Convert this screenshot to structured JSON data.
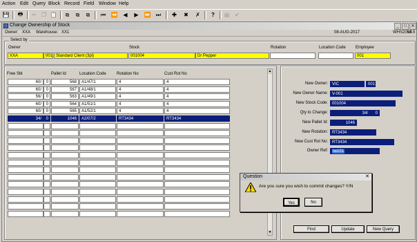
{
  "menu": [
    "Action",
    "Edit",
    "Query",
    "Block",
    "Record",
    "Field",
    "Window",
    "Help"
  ],
  "window": {
    "title": "Change Ownership of Stock"
  },
  "info": {
    "owner_label": "Owner:",
    "owner": "XXA",
    "warehouse_label": "Warehouse:",
    "warehouse": "XX1",
    "date": "08-AUG-2017",
    "program": "WHS2053",
    "version": "v4.5"
  },
  "select_by": {
    "title": "Select by",
    "owner_label": "Owner",
    "owner_code": "XXA",
    "owner_num": "001",
    "owner_name": "Standard Client (3pl)",
    "stock_label": "Stock",
    "stock_code": "001004",
    "stock_name": "Dr Pepper",
    "rotation_label": "Rotation",
    "rotation": "",
    "location_label": "Location Code",
    "location": "",
    "employee_label": "Employee",
    "employee": "001"
  },
  "grid": {
    "headers": [
      "Free Stk",
      "Pallet Id",
      "Location Code",
      "Rotation No",
      "Cust Rot No"
    ],
    "rows": [
      {
        "free": "60/",
        "free2": "0",
        "pallet": "568",
        "location": "A1/47/1",
        "rotation": "4",
        "cust_rot": "4",
        "selected": false
      },
      {
        "free": "60/",
        "free2": "0",
        "pallet": "567",
        "location": "A1/48/1",
        "rotation": "4",
        "cust_rot": "4",
        "selected": false
      },
      {
        "free": "56/",
        "free2": "0",
        "pallet": "563",
        "location": "A1/49/1",
        "rotation": "4",
        "cust_rot": "4",
        "selected": false
      },
      {
        "free": "60/",
        "free2": "0",
        "pallet": "564",
        "location": "A1/51/1",
        "rotation": "4",
        "cust_rot": "4",
        "selected": false
      },
      {
        "free": "60/",
        "free2": "0",
        "pallet": "565",
        "location": "A1/52/1",
        "rotation": "4",
        "cust_rot": "4",
        "selected": false
      },
      {
        "free": "34/",
        "free2": "0",
        "pallet": "1046",
        "location": "A2/07/2",
        "rotation": "RT3434",
        "cust_rot": "RT3434",
        "selected": true
      }
    ],
    "empty_rows": 13
  },
  "right": {
    "new_owner_label": "New Owner:",
    "new_owner": "VIC",
    "new_owner_num": "001",
    "new_owner_name_label": "New Owner Name:",
    "new_owner_name": "V-001",
    "new_stock_label": "New Stock Code:",
    "new_stock": "001004",
    "qty_label": "Qty to Change:",
    "qty": "34/",
    "qty2": "0",
    "new_pallet_label": "New Pallet Id:",
    "new_pallet": "1046",
    "new_rotation_label": "New Rotation:",
    "new_rotation": "RT3434",
    "new_cust_rot_label": "New Cust Rot No:",
    "new_cust_rot": "RT3434",
    "owner_ref_label": "Owner Ref:",
    "owner_ref": "tw101"
  },
  "buttons": {
    "find": "Find",
    "update": "Update",
    "new_query": "New Query"
  },
  "dialog": {
    "title": "Question",
    "message": "Are you sure you wish to commit changes? Y/N",
    "yes": "Yes",
    "no": "No"
  }
}
